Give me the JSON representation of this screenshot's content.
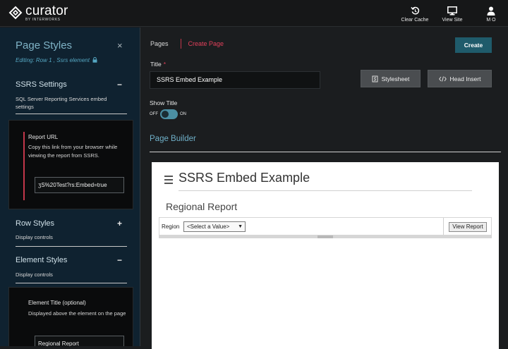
{
  "header": {
    "logo_name": "curator",
    "logo_sub": "BY INTERWORKS",
    "actions": [
      {
        "label": "Clear Cache",
        "icon": "refresh-icon"
      },
      {
        "label": "View Site",
        "icon": "monitor-icon"
      },
      {
        "label": "M O",
        "icon": "user-icon"
      }
    ]
  },
  "sidebar": {
    "title": "Page Styles",
    "close": "×",
    "editing": "Editing: Row 1 , Ssrs element",
    "ssrs": {
      "title": "SSRS Settings",
      "toggle": "−",
      "desc": "SQL Server Reporting Services embed settings",
      "report_url_label": "Report URL",
      "report_url_help": "Copy this link from your browser while viewing the report from SSRS.",
      "report_url_value": "ʒS%20Test?rs:Embed=true"
    },
    "row_styles": {
      "title": "Row Styles",
      "toggle": "+",
      "desc": "Display controls"
    },
    "element_styles": {
      "title": "Element Styles",
      "toggle": "−",
      "desc": "Display controls",
      "element_title_label": "Element Title (optional)",
      "element_title_help": "Displayed above the element on the page",
      "element_title_value": "Regional Report"
    }
  },
  "main": {
    "tabs": {
      "pages": "Pages",
      "create": "Create Page"
    },
    "create_button": "Create",
    "title_label": "Title",
    "title_required": "*",
    "title_value": "SSRS Embed Example",
    "stylesheet_button": "Stylesheet",
    "head_insert_button": "Head Insert",
    "show_title_label": "Show Title",
    "toggle_off": "OFF",
    "toggle_on": "ON",
    "page_builder_title": "Page Builder"
  },
  "canvas": {
    "page_title": "SSRS Embed Example",
    "element_title": "Regional Report",
    "region_label": "Region",
    "region_select": "<Select a Value>",
    "view_report_button": "View Report"
  },
  "colors": {
    "accent_teal": "#1f5b6b",
    "accent_red": "#e0405a",
    "sidebar_bg": "#0f2230"
  }
}
